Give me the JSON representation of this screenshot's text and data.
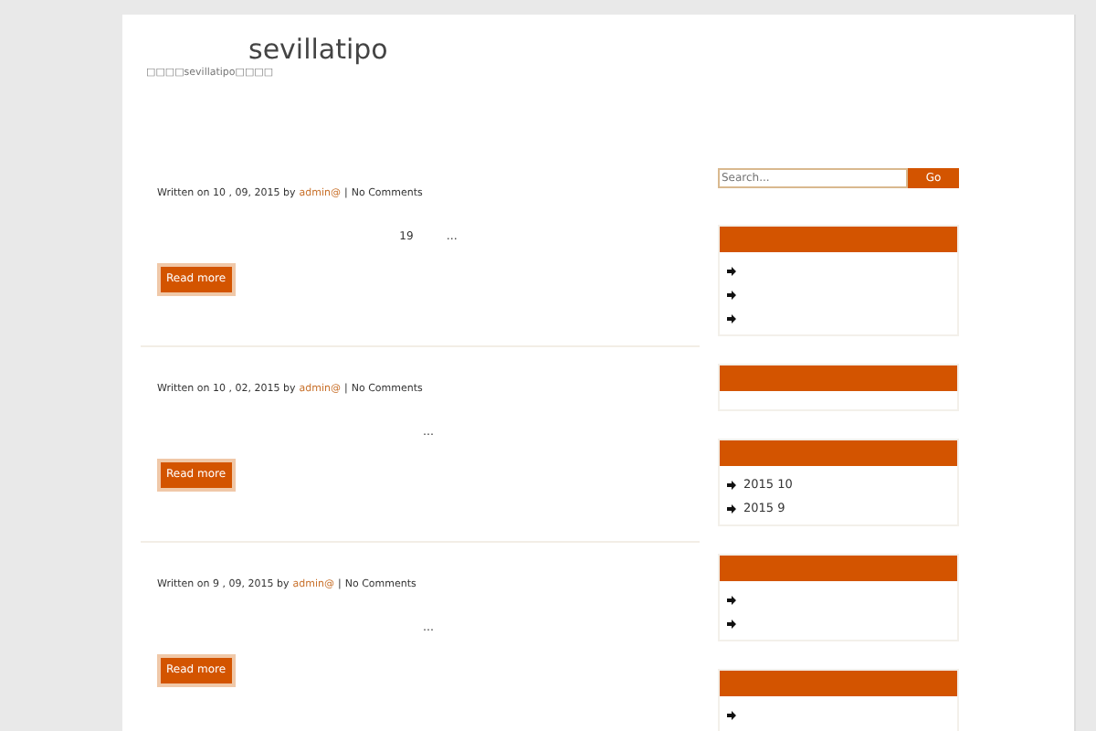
{
  "site": {
    "title": "sevillatipo",
    "tagline": "□□□□sevillatipo□□□□"
  },
  "posts": [
    {
      "written": "Written on 10 , 09, 2015 by",
      "author": "admin@",
      "separator": "|",
      "comments": "No Comments",
      "excerpt": [
        "19",
        "…"
      ],
      "button": "Read more"
    },
    {
      "written": "Written on 10 , 02, 2015 by",
      "author": "admin@",
      "separator": "|",
      "comments": "No Comments",
      "excerpt": [
        "…"
      ],
      "button": "Read more"
    },
    {
      "written": "Written on 9 , 09, 2015 by",
      "author": "admin@",
      "separator": "|",
      "comments": "No Comments",
      "excerpt": [
        "…"
      ],
      "button": "Read more"
    }
  ],
  "search": {
    "placeholder": "Search...",
    "button": "Go"
  },
  "widgets": [
    {
      "kind": "list",
      "items": [
        {
          "kind": "bullet"
        },
        {
          "kind": "bullet"
        },
        {
          "kind": "bullet"
        }
      ]
    },
    {
      "kind": "empty"
    },
    {
      "kind": "list",
      "items": [
        {
          "kind": "link",
          "label": "2015  10"
        },
        {
          "kind": "link",
          "label": "2015  9"
        }
      ]
    },
    {
      "kind": "list",
      "items": [
        {
          "kind": "bullet"
        },
        {
          "kind": "bullet"
        }
      ]
    },
    {
      "kind": "list",
      "items": [
        {
          "kind": "bullet"
        }
      ]
    }
  ]
}
